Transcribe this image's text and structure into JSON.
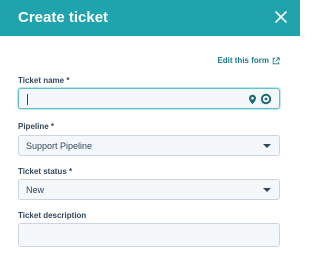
{
  "header": {
    "title": "Create ticket",
    "close_icon": "close-icon",
    "bg_color": "#1fa3ad"
  },
  "form": {
    "edit_link": "Edit this form",
    "edit_link_icon": "external-link-icon",
    "ticket_name": {
      "label": "Ticket name *",
      "value": "",
      "icons": [
        "location-pin-icon",
        "chat-bubble-icon"
      ]
    },
    "pipeline": {
      "label": "Pipeline *",
      "value": "Support Pipeline"
    },
    "ticket_status": {
      "label": "Ticket status *",
      "value": "New"
    },
    "ticket_description": {
      "label": "Ticket description",
      "value": ""
    }
  }
}
